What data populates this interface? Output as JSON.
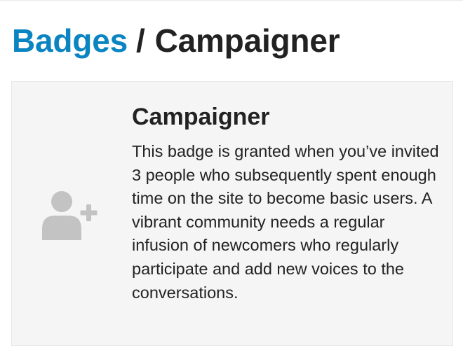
{
  "breadcrumb": {
    "parent_label": "Badges",
    "separator": "/",
    "current_label": "Campaigner"
  },
  "badge": {
    "icon": "user-plus-icon",
    "title": "Campaigner",
    "description": "This badge is granted when you’ve invited 3 people who subsequently spent enough time on the site to become basic users. A vibrant community needs a regular infusion of newcomers who regularly participate and add new voices to the conversations."
  },
  "colors": {
    "link": "#0a85c2",
    "text": "#222222",
    "card_background": "#f5f5f5",
    "icon": "#c3c3c3"
  }
}
